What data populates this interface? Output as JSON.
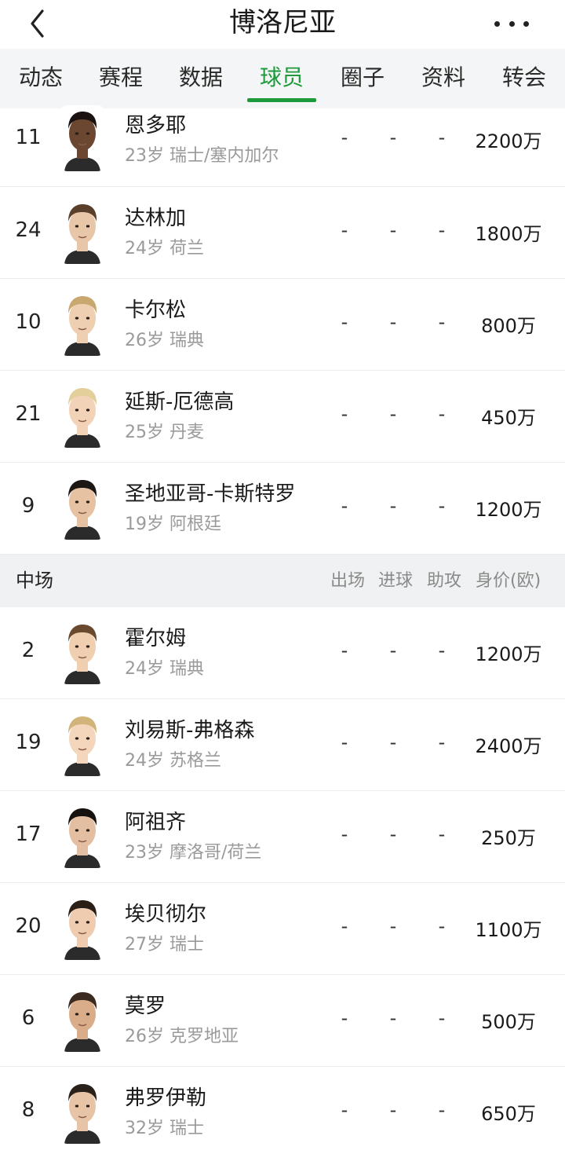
{
  "header": {
    "title": "博洛尼亚"
  },
  "tabs": [
    {
      "label": "动态"
    },
    {
      "label": "赛程"
    },
    {
      "label": "数据"
    },
    {
      "label": "球员"
    },
    {
      "label": "圈子"
    },
    {
      "label": "资料"
    },
    {
      "label": "转会"
    }
  ],
  "active_tab": "球员",
  "forwards": [
    {
      "number": "11",
      "name": "恩多耶",
      "info": "23岁 瑞士/塞内加尔",
      "apps": "-",
      "goals": "-",
      "assists": "-",
      "value": "2200万"
    },
    {
      "number": "24",
      "name": "达林加",
      "info": "24岁 荷兰",
      "apps": "-",
      "goals": "-",
      "assists": "-",
      "value": "1800万"
    },
    {
      "number": "10",
      "name": "卡尔松",
      "info": "26岁 瑞典",
      "apps": "-",
      "goals": "-",
      "assists": "-",
      "value": "800万"
    },
    {
      "number": "21",
      "name": "延斯-厄德高",
      "info": "25岁 丹麦",
      "apps": "-",
      "goals": "-",
      "assists": "-",
      "value": "450万"
    },
    {
      "number": "9",
      "name": "圣地亚哥-卡斯特罗",
      "info": "19岁 阿根廷",
      "apps": "-",
      "goals": "-",
      "assists": "-",
      "value": "1200万"
    }
  ],
  "midfield_header": {
    "label": "中场",
    "col_apps": "出场",
    "col_goals": "进球",
    "col_assists": "助攻",
    "col_value": "身价(欧)"
  },
  "midfielders": [
    {
      "number": "2",
      "name": "霍尔姆",
      "info": "24岁 瑞典",
      "apps": "-",
      "goals": "-",
      "assists": "-",
      "value": "1200万"
    },
    {
      "number": "19",
      "name": "刘易斯-弗格森",
      "info": "24岁 苏格兰",
      "apps": "-",
      "goals": "-",
      "assists": "-",
      "value": "2400万"
    },
    {
      "number": "17",
      "name": "阿祖齐",
      "info": "23岁 摩洛哥/荷兰",
      "apps": "-",
      "goals": "-",
      "assists": "-",
      "value": "250万"
    },
    {
      "number": "20",
      "name": "埃贝彻尔",
      "info": "27岁 瑞士",
      "apps": "-",
      "goals": "-",
      "assists": "-",
      "value": "1100万"
    },
    {
      "number": "6",
      "name": "莫罗",
      "info": "26岁 克罗地亚",
      "apps": "-",
      "goals": "-",
      "assists": "-",
      "value": "500万"
    },
    {
      "number": "8",
      "name": "弗罗伊勒",
      "info": "32岁 瑞士",
      "apps": "-",
      "goals": "-",
      "assists": "-",
      "value": "650万"
    }
  ],
  "colors": {
    "accent": "#1d9b3a",
    "tab_bar_bg": "#f4f5f6",
    "section_bg": "#f0f1f2",
    "muted_text": "#9a9a9a"
  },
  "icons": {
    "back": "chevron-left-icon",
    "more": "more-dots-icon",
    "avatar": "player-photo"
  }
}
